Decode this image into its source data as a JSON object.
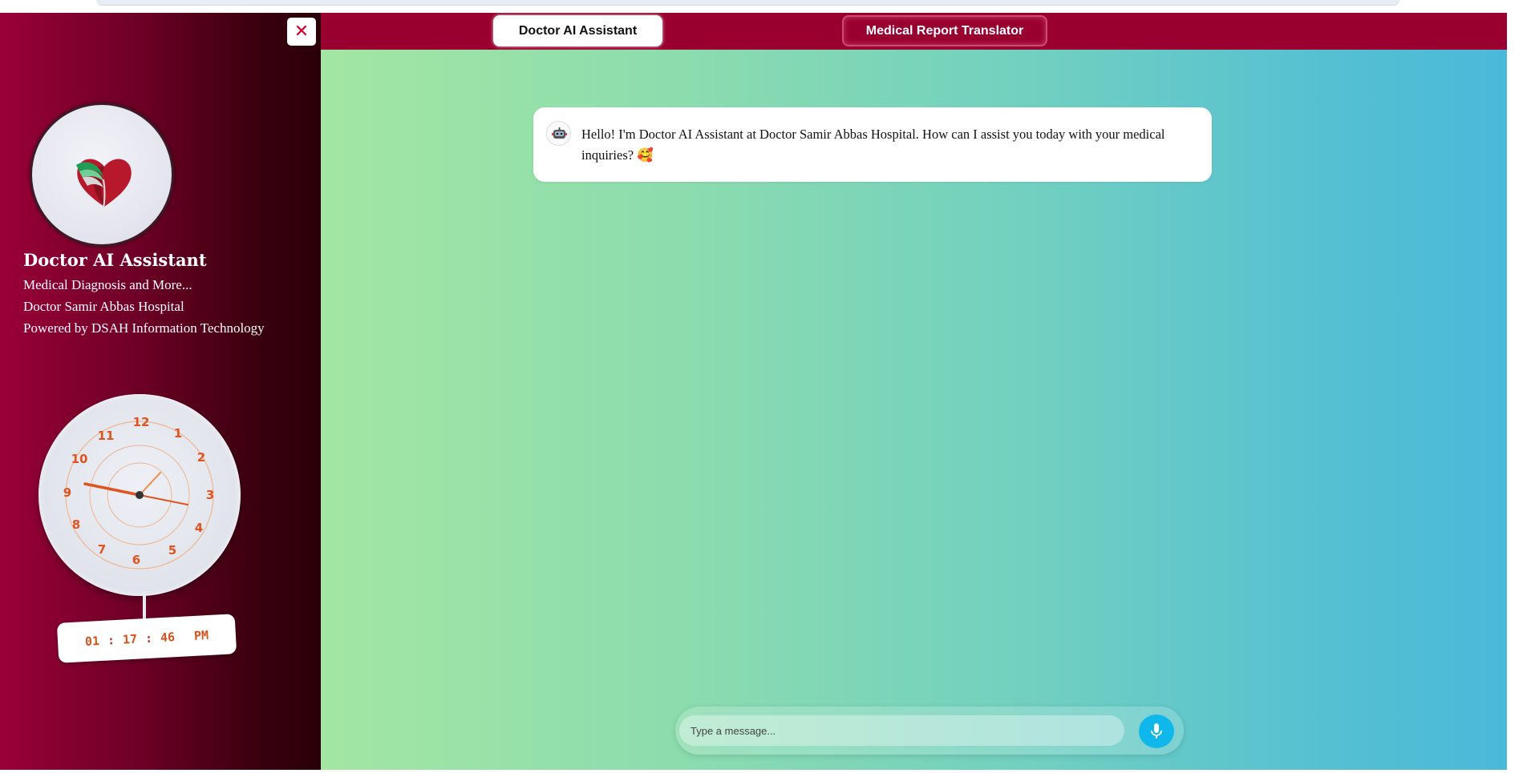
{
  "tabs": [
    {
      "label": "Doctor AI Assistant",
      "active": true
    },
    {
      "label": "Medical Report Translator",
      "active": false
    }
  ],
  "sidebar": {
    "close_glyph": "✕",
    "title": "Doctor AI Assistant",
    "lines": [
      "Medical Diagnosis and More...",
      "Doctor Samir Abbas Hospital",
      "Powered by DSAH Information Technology"
    ],
    "clock": {
      "numbers": [
        "12",
        "1",
        "2",
        "3",
        "4",
        "5",
        "6",
        "7",
        "8",
        "9",
        "10",
        "11"
      ],
      "hours": "01",
      "minutes": "17",
      "seconds": "46",
      "separator": ":",
      "period": "PM"
    }
  },
  "chat": {
    "messages": [
      {
        "role": "assistant",
        "avatar_icon": "robot-icon",
        "text": "Hello! I'm Doctor AI Assistant at Doctor Samir Abbas Hospital. How can I assist you today with your medical inquiries? 🥰"
      }
    ]
  },
  "composer": {
    "placeholder": "Type a message...",
    "value": "",
    "mic_icon": "microphone-icon"
  },
  "colors": {
    "brand": "#99002f",
    "mic": "#0fb7ea",
    "accent_clock": "#e06a2a"
  }
}
